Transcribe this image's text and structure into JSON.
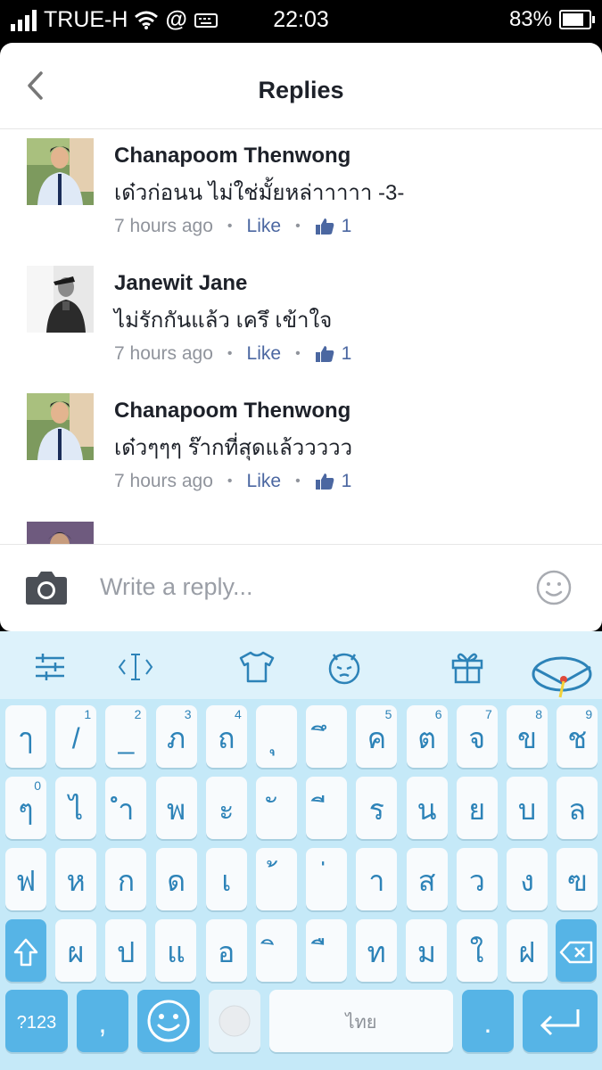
{
  "status": {
    "carrier": "TRUE-H",
    "at": "@",
    "time": "22:03",
    "battery": "83%",
    "battery_level": 0.83
  },
  "header": {
    "title": "Replies"
  },
  "comments": [
    {
      "name": "Chanapoom Thenwong",
      "text": "เด๋วก่อนน ไม่ใช่มั้ยหล่าาาาา -3-",
      "time": "7 hours ago",
      "like": "Like",
      "likes": "1"
    },
    {
      "name": "Janewit Jane",
      "text": "ไม่รักกันแล้ว เครึ เข้าใจ",
      "time": "7 hours ago",
      "like": "Like",
      "likes": "1"
    },
    {
      "name": "Chanapoom Thenwong",
      "text": "เด๋วๆๆๆ ร๊ากที่สุดแล้ววววว",
      "time": "7 hours ago",
      "like": "Like",
      "likes": "1"
    }
  ],
  "reply": {
    "placeholder": "Write a reply..."
  },
  "keyboard": {
    "row1": [
      {
        "k": "ๅ",
        "n": ""
      },
      {
        "k": "/",
        "n": "1"
      },
      {
        "k": "_",
        "n": "2"
      },
      {
        "k": "ภ",
        "n": "3"
      },
      {
        "k": "ถ",
        "n": "4"
      },
      {
        "k": "ุ",
        "n": ""
      },
      {
        "k": "ึ",
        "n": ""
      },
      {
        "k": "ค",
        "n": "5"
      },
      {
        "k": "ต",
        "n": "6"
      },
      {
        "k": "จ",
        "n": "7"
      },
      {
        "k": "ข",
        "n": "8"
      },
      {
        "k": "ช",
        "n": "9"
      }
    ],
    "row2": [
      {
        "k": "ๆ",
        "n": "0"
      },
      {
        "k": "ไ",
        "n": ""
      },
      {
        "k": "ำ",
        "n": ""
      },
      {
        "k": "พ",
        "n": ""
      },
      {
        "k": "ะ",
        "n": ""
      },
      {
        "k": "ั",
        "n": ""
      },
      {
        "k": "ี",
        "n": ""
      },
      {
        "k": "ร",
        "n": ""
      },
      {
        "k": "น",
        "n": ""
      },
      {
        "k": "ย",
        "n": ""
      },
      {
        "k": "บ",
        "n": ""
      },
      {
        "k": "ล",
        "n": ""
      }
    ],
    "row3": [
      {
        "k": "ฟ",
        "n": ""
      },
      {
        "k": "ห",
        "n": ""
      },
      {
        "k": "ก",
        "n": ""
      },
      {
        "k": "ด",
        "n": ""
      },
      {
        "k": "เ",
        "n": ""
      },
      {
        "k": "้",
        "n": ""
      },
      {
        "k": "่",
        "n": ""
      },
      {
        "k": "า",
        "n": ""
      },
      {
        "k": "ส",
        "n": ""
      },
      {
        "k": "ว",
        "n": ""
      },
      {
        "k": "ง",
        "n": ""
      },
      {
        "k": "ฃ",
        "n": ""
      }
    ],
    "row4": [
      {
        "k": "ผ",
        "n": ""
      },
      {
        "k": "ป",
        "n": ""
      },
      {
        "k": "แ",
        "n": ""
      },
      {
        "k": "อ",
        "n": ""
      },
      {
        "k": "ิ",
        "n": ""
      },
      {
        "k": "ื",
        "n": ""
      },
      {
        "k": "ท",
        "n": ""
      },
      {
        "k": "ม",
        "n": ""
      },
      {
        "k": "ใ",
        "n": ""
      },
      {
        "k": "ฝ",
        "n": ""
      }
    ],
    "num_key": "?123",
    "comma_key": ",",
    "space_label": "ไทย",
    "period_key": "."
  },
  "colors": {
    "link": "#4b67a1",
    "keyText": "#2d83b8",
    "keyDark": "#56b4e6"
  }
}
